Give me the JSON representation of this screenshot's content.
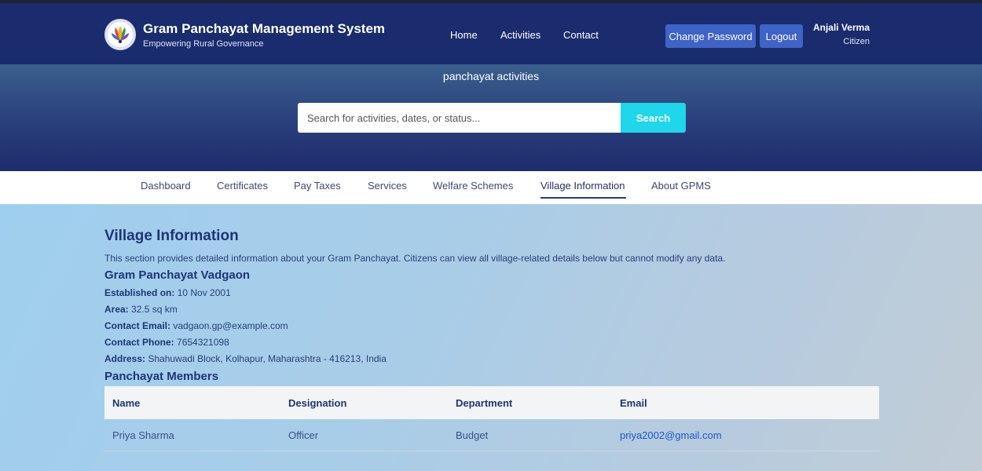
{
  "header": {
    "brand_title": "Gram Panchayat Management System",
    "brand_subtitle": "Empowering Rural Governance",
    "nav": [
      "Home",
      "Activities",
      "Contact"
    ],
    "change_password": "Change Password",
    "logout": "Logout",
    "user_name": "Anjali Verma",
    "user_role": "Citizen"
  },
  "hero": {
    "title": "panchayat activities",
    "search_placeholder": "Search for activities, dates, or status...",
    "search_button": "Search"
  },
  "subnav": {
    "items": [
      "Dashboard",
      "Certificates",
      "Pay Taxes",
      "Services",
      "Welfare Schemes",
      "Village Information",
      "About GPMS"
    ],
    "active": "Village Information"
  },
  "village": {
    "title": "Village Information",
    "description": "This section provides detailed information about your Gram Panchayat. Citizens can view all village-related details below but cannot modify any data.",
    "gp_name": "Gram Panchayat Vadgaon",
    "established_label": "Established on:",
    "established_value": "10 Nov 2001",
    "area_label": "Area:",
    "area_value": "32.5 sq km",
    "email_label": "Contact Email:",
    "email_value": "vadgaon.gp@example.com",
    "phone_label": "Contact Phone:",
    "phone_value": "7654321098",
    "address_label": "Address:",
    "address_value": "Shahuwadi Block, Kolhapur, Maharashtra - 416213, India"
  },
  "members": {
    "title": "Panchayat Members",
    "columns": [
      "Name",
      "Designation",
      "Department",
      "Email"
    ],
    "rows": [
      {
        "name": "Priya Sharma",
        "designation": "Officer",
        "department": "Budget",
        "email": "priya2002@gmail.com"
      }
    ]
  },
  "colors": {
    "navbar": "#1a2c6e",
    "accent_button": "#3f63c6",
    "search_button": "#1fd6ea",
    "heading": "#1f3576",
    "link": "#1f57c3"
  },
  "icons": {
    "logo": "gram-panchayat-logo-icon"
  }
}
